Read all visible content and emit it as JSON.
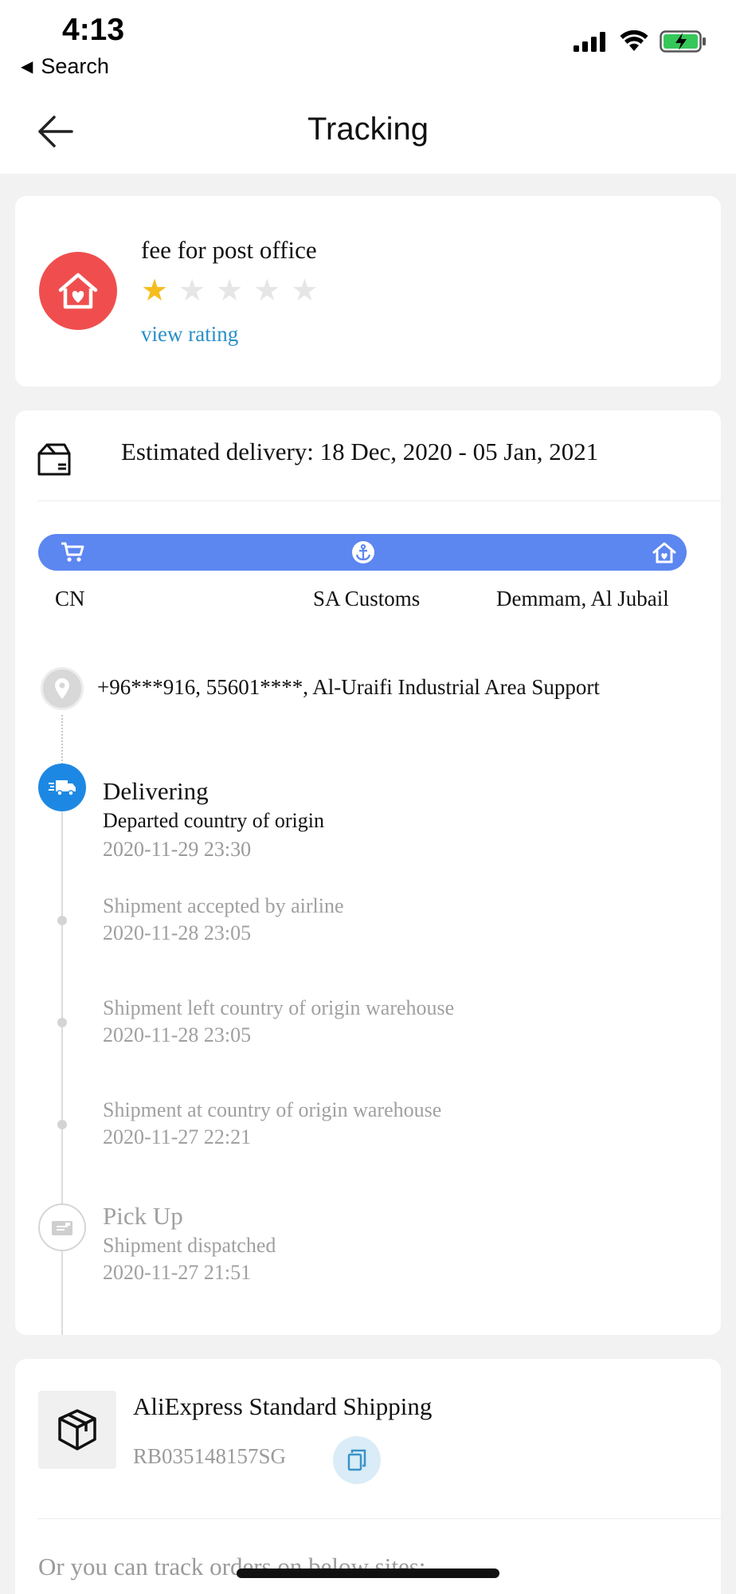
{
  "status_bar": {
    "time": "4:13",
    "back_app": "Search"
  },
  "nav": {
    "title": "Tracking"
  },
  "seller": {
    "name": "fee for post office",
    "rating_value": 1,
    "rating_max": 5,
    "view_rating_label": "view rating",
    "avatar_color": "#f04e4e"
  },
  "tracking": {
    "estimated_delivery": "Estimated delivery: 18 Dec, 2020 - 05 Jan, 2021",
    "progress_color": "#5c86f0",
    "stages": [
      "CN",
      "SA Customs",
      "Demmam, Al Jubail"
    ],
    "address": "+96***916,  55601****,  Al-Uraifi Industrial Area Support",
    "current_status": {
      "title": "Delivering",
      "description": "Departed country of origin",
      "time": "2020-11-29 23:30"
    },
    "events": [
      {
        "description": "Shipment accepted by airline",
        "time": "2020-11-28 23:05"
      },
      {
        "description": "Shipment left country of origin warehouse",
        "time": "2020-11-28 23:05"
      },
      {
        "description": "Shipment at country of origin warehouse",
        "time": "2020-11-27 22:21"
      }
    ],
    "pickup": {
      "title": "Pick Up",
      "description": "Shipment dispatched",
      "time": "2020-11-27 21:51"
    }
  },
  "shipping": {
    "carrier": "AliExpress Standard Shipping",
    "tracking_number": "RB035148157SG",
    "track_sites_text": "Or you can track orders on below sites:"
  }
}
